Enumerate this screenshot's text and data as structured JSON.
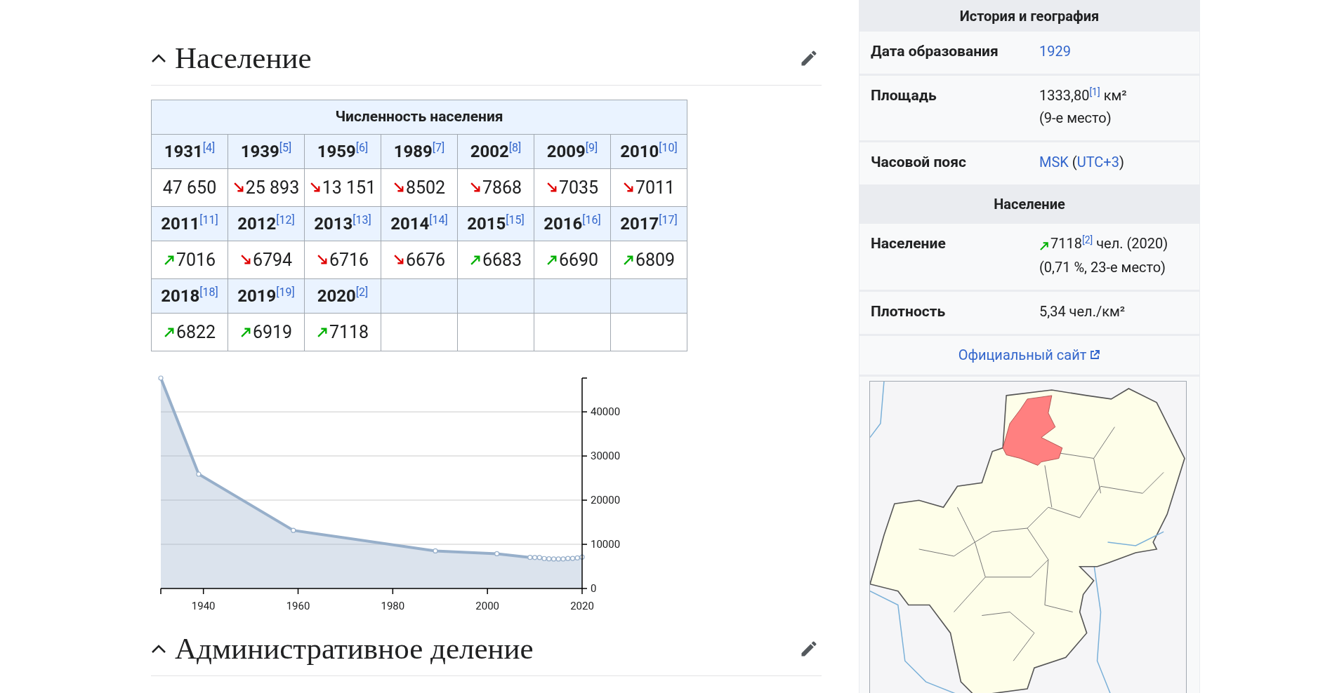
{
  "sections": [
    {
      "title": "Население",
      "expanded": true
    },
    {
      "title": "Административное деление",
      "expanded": true
    }
  ],
  "population_table": {
    "title": "Численность населения",
    "entries": [
      {
        "year": "1931",
        "ref": "[4]",
        "value": "47 650"
      },
      {
        "year": "1939",
        "ref": "[5]",
        "value": "25 893",
        "increase": false
      },
      {
        "year": "1959",
        "ref": "[6]",
        "value": "13 151",
        "increase": false
      },
      {
        "year": "1989",
        "ref": "[7]",
        "value": "8502",
        "increase": false
      },
      {
        "year": "2002",
        "ref": "[8]",
        "value": "7868",
        "increase": false
      },
      {
        "year": "2009",
        "ref": "[9]",
        "value": "7035",
        "increase": false
      },
      {
        "year": "2010",
        "ref": "[10]",
        "value": "7011",
        "increase": false
      },
      {
        "year": "2011",
        "ref": "[11]",
        "value": "7016",
        "increase": true
      },
      {
        "year": "2012",
        "ref": "[12]",
        "value": "6794",
        "increase": false
      },
      {
        "year": "2013",
        "ref": "[13]",
        "value": "6716",
        "increase": false
      },
      {
        "year": "2014",
        "ref": "[14]",
        "value": "6676",
        "increase": false
      },
      {
        "year": "2015",
        "ref": "[15]",
        "value": "6683",
        "increase": true
      },
      {
        "year": "2016",
        "ref": "[16]",
        "value": "6690",
        "increase": true
      },
      {
        "year": "2017",
        "ref": "[17]",
        "value": "6809",
        "increase": true
      },
      {
        "year": "2018",
        "ref": "[18]",
        "value": "6822",
        "increase": true
      },
      {
        "year": "2019",
        "ref": "[19]",
        "value": "6919",
        "increase": true
      },
      {
        "year": "2020",
        "ref": "[2]",
        "value": "7118",
        "increase": true
      }
    ]
  },
  "chart_data": {
    "type": "area",
    "x": [
      1931,
      1939,
      1959,
      1989,
      2002,
      2009,
      2010,
      2011,
      2012,
      2013,
      2014,
      2015,
      2016,
      2017,
      2018,
      2019,
      2020
    ],
    "series": [
      {
        "color": "#97afca",
        "values": [
          47650,
          25893,
          13151,
          8502,
          7868,
          7035,
          7011,
          7016,
          6794,
          6716,
          6676,
          6683,
          6690,
          6809,
          6822,
          6919,
          7118
        ]
      }
    ],
    "xlim": [
      1931,
      2020
    ],
    "ylim": [
      0,
      47650
    ],
    "xticks": [
      1940,
      1960,
      1980,
      2000,
      2020
    ],
    "yticks": [
      0,
      10000,
      20000,
      30000,
      40000
    ],
    "grid": true
  },
  "infobox": {
    "sections": [
      {
        "title": "История и география",
        "rows": [
          {
            "label": "Дата образования",
            "lines": [
              [
                {
                  "kind": "link",
                  "text": "1929"
                }
              ]
            ]
          },
          {
            "label": "Площадь",
            "lines": [
              [
                {
                  "kind": "text",
                  "text": "1333,80"
                },
                {
                  "kind": "ref",
                  "text": "[1]"
                },
                {
                  "kind": "text",
                  "text": " км²"
                }
              ],
              [
                {
                  "kind": "text",
                  "text": "(9-е место)"
                }
              ]
            ]
          },
          {
            "label": "Часовой пояс",
            "lines": [
              [
                {
                  "kind": "link",
                  "text": "MSK"
                },
                {
                  "kind": "text",
                  "text": " ("
                },
                {
                  "kind": "link",
                  "text": "UTC+3"
                },
                {
                  "kind": "text",
                  "text": ")"
                }
              ]
            ]
          }
        ]
      },
      {
        "title": "Население",
        "rows": [
          {
            "label": "Население",
            "lines": [
              [
                {
                  "kind": "trend_up"
                },
                {
                  "kind": "text",
                  "text": "7118"
                },
                {
                  "kind": "ref",
                  "text": "[2]"
                },
                {
                  "kind": "text",
                  "text": " чел. (2020)"
                }
              ],
              [
                {
                  "kind": "text",
                  "text": "(0,71 %, 23-е место)"
                }
              ]
            ]
          },
          {
            "label": "Плотность",
            "lines": [
              [
                {
                  "kind": "text",
                  "text": "5,34 чел./км²"
                }
              ]
            ]
          }
        ]
      }
    ],
    "website": {
      "label": "Официальный сайт"
    }
  }
}
